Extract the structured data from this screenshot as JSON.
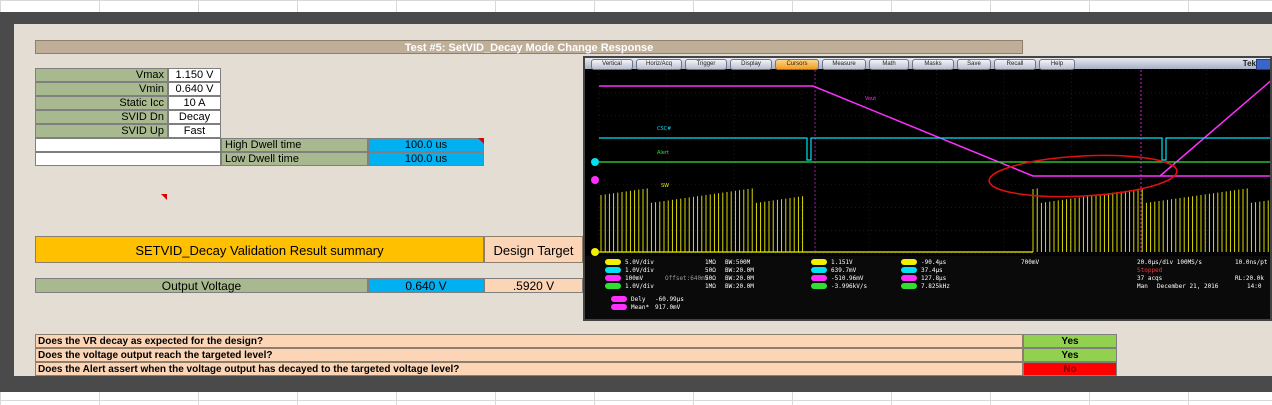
{
  "test_title": "Test #5: SetVID_Decay Mode Change Response",
  "params": [
    {
      "label": "Vmax",
      "value": "1.150 V"
    },
    {
      "label": "Vmin",
      "value": "0.640 V"
    },
    {
      "label": "Static Icc",
      "value": "10 A"
    },
    {
      "label": "SVID Dn",
      "value": "Decay"
    },
    {
      "label": "SVID Up",
      "value": "Fast"
    }
  ],
  "dwell": [
    {
      "label": "High Dwell time",
      "value": "100.0 us"
    },
    {
      "label": "Low Dwell time",
      "value": "100.0 us"
    }
  ],
  "summary": {
    "title": "SETVID_Decay Validation Result summary",
    "target_header": "Design Target"
  },
  "output_voltage": {
    "label": "Output Voltage",
    "value": "0.640 V",
    "target": ".5920 V"
  },
  "questions": [
    {
      "text": "Does the VR decay as expected for the design?",
      "answer": "Yes"
    },
    {
      "text": "Does the voltage output reach the targeted level?",
      "answer": "Yes"
    },
    {
      "text": "Does the Alert assert when the voltage output has decayed to the targeted voltage level?",
      "answer": "No"
    }
  ],
  "scope": {
    "brand": "Tek",
    "menu": [
      "Vertical",
      "Horiz/Acq",
      "Trigger",
      "Display",
      "Cursors",
      "Measure",
      "Math",
      "Masks",
      "Save",
      "Recall",
      "Help"
    ],
    "active_menu": "Cursors",
    "trace_labels": {
      "vout": "Vout",
      "csc": "CSC#",
      "alert": "Alert",
      "sw": "SW"
    },
    "channels": [
      {
        "ch": "C1",
        "scale": "5.0V/div",
        "imp": "1MΩ",
        "bw": "BW:500M"
      },
      {
        "ch": "C2",
        "scale": "1.0V/div",
        "imp": "50Ω",
        "bw": "BW:20.0M"
      },
      {
        "ch": "C3",
        "scale": "100mV",
        "offset": "Offset:640mV",
        "imp": "50Ω",
        "bw": "BW:20.0M"
      },
      {
        "ch": "C4",
        "scale": "1.0V/div",
        "imp": "1MΩ",
        "bw": "BW:20.0M"
      }
    ],
    "cursor_values": [
      "1.151V",
      "639.7mV",
      "-510.96mV",
      "-3.996kV/s"
    ],
    "cursor_times": [
      "-90.4µs",
      "37.4µs",
      "127.8µs",
      "7.825kHz"
    ],
    "trigger": "700mV",
    "timebase": "20.0µs/div 100MS/s",
    "sample": "10.0ns/pt",
    "state": "Stopped",
    "acqs": "37 acqs",
    "record": "RL:20.0k",
    "mode": "Man",
    "date": "December 21, 2016",
    "time": "14:0",
    "delay_label": "Dely",
    "delay_value": "-60.99µs",
    "mean_label": "Mean*",
    "mean_value": "917.0mV",
    "colors": {
      "c1": "#f0f000",
      "c2": "#00e0f0",
      "c3": "#ff30ff",
      "c4": "#30e030",
      "annot": "#e01010"
    }
  }
}
